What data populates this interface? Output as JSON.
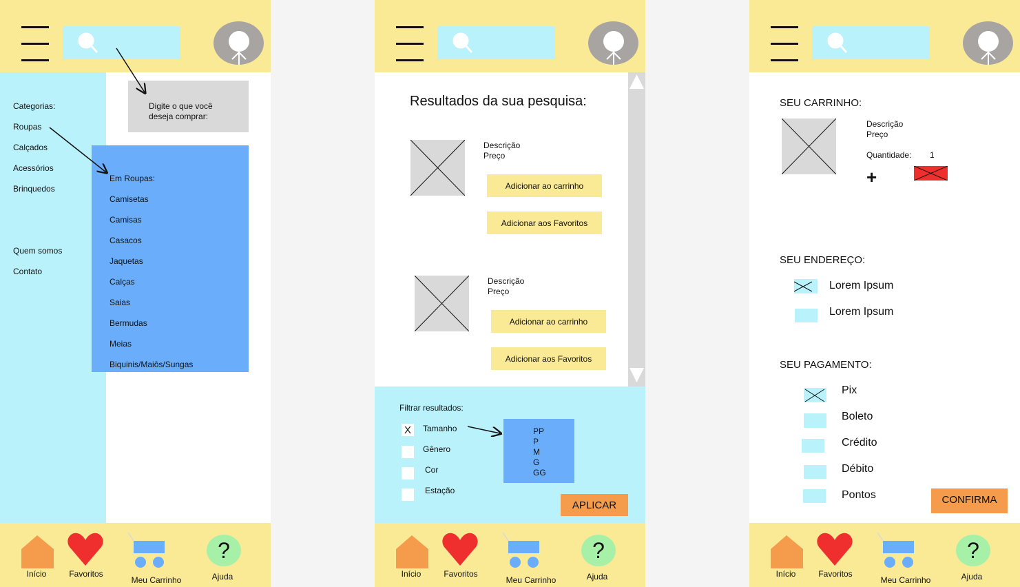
{
  "colors": {
    "yellow": "#fbea95",
    "cyan": "#b9f2fb",
    "blue": "#6aaefb",
    "orange": "#f59b4c",
    "red": "#ef2e2e",
    "green": "#a7f0a7",
    "gray": "#d9d9d9"
  },
  "screen1": {
    "sidebar": {
      "categories_title": "Categorias:",
      "items": [
        "Roupas",
        "Calçados",
        "Acessórios",
        "Brinquedos"
      ],
      "extra_items": [
        "Quem somos",
        "Contato"
      ]
    },
    "search_tooltip": "Digite o que você deseja comprar:",
    "submenu": {
      "title": "Em Roupas:",
      "items": [
        "Camisetas",
        "Camisas",
        "Casacos",
        "Jaquetas",
        "Calças",
        "Saias",
        "Bermudas",
        "Meias",
        "Biquinis/Maiôs/Sungas"
      ]
    }
  },
  "screen2": {
    "results_title": "Resultados da sua pesquisa:",
    "products": [
      {
        "description": "Descrição",
        "price": "Preço",
        "add_cart": "Adicionar ao carrinho",
        "add_fav": "Adicionar aos Favoritos"
      },
      {
        "description": "Descrição",
        "price": "Preço",
        "add_cart": "Adicionar ao carrinho",
        "add_fav": "Adicionar aos Favoritos"
      }
    ],
    "filter": {
      "title": "Filtrar resultados:",
      "options": [
        {
          "label": "Tamanho",
          "mark": "X"
        },
        {
          "label": "Gênero",
          "mark": ""
        },
        {
          "label": "Cor",
          "mark": ""
        },
        {
          "label": "Estação",
          "mark": ""
        }
      ],
      "sizes": [
        "PP",
        "P",
        "M",
        "G",
        "GG"
      ],
      "apply": "APLICAR"
    }
  },
  "screen3": {
    "cart_title": "SEU CARRINHO:",
    "item": {
      "description": "Descrição",
      "price": "Preço",
      "qty_label": "Quantidade:",
      "qty": "1",
      "plus": "+"
    },
    "address_title": "SEU ENDEREÇO:",
    "addresses": [
      "Lorem Ipsum",
      "Lorem Ipsum"
    ],
    "payment_title": "SEU PAGAMENTO:",
    "payments": [
      "Pix",
      "Boleto",
      "Crédito",
      "Débito",
      "Pontos"
    ],
    "confirm": "CONFIRMA"
  },
  "nav": {
    "home": "Início",
    "favorites": "Favoritos",
    "cart": "Meu Carrinho",
    "help": "Ajuda",
    "help_symbol": "?"
  }
}
